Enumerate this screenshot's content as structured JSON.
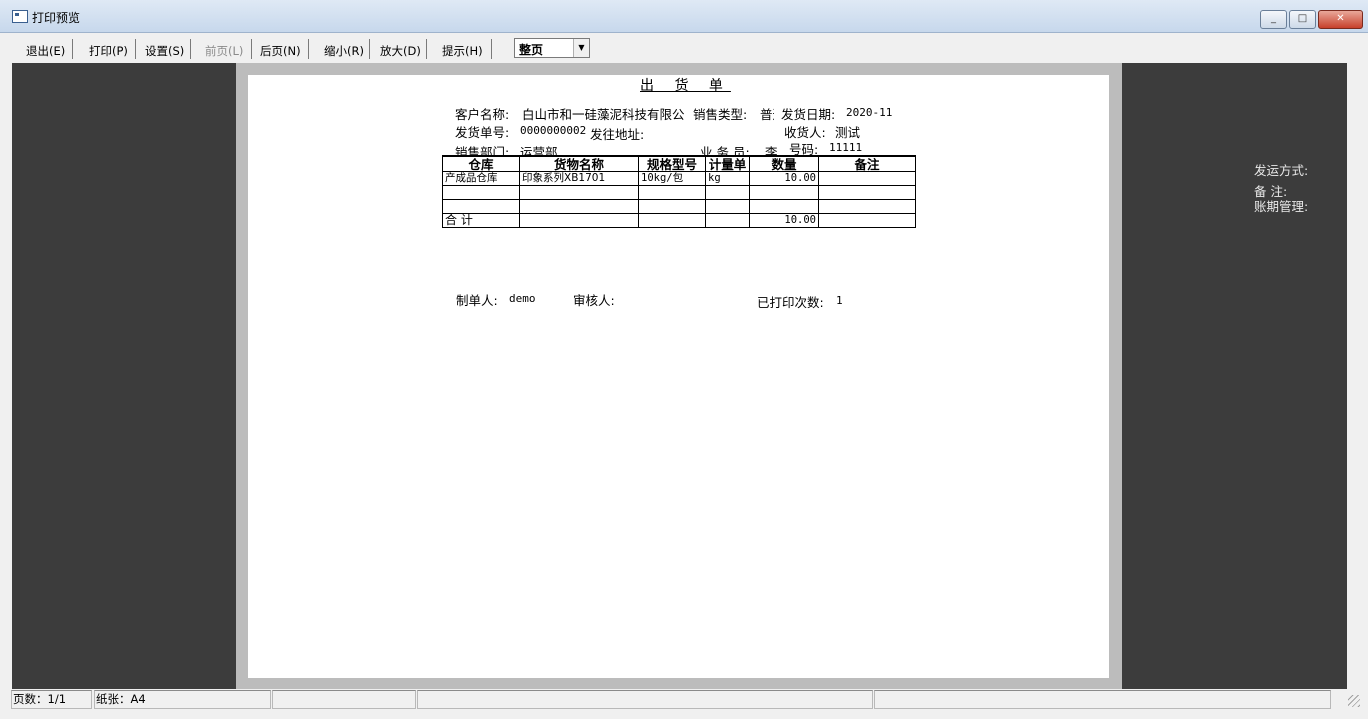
{
  "window": {
    "title": "打印预览",
    "minimize": "_",
    "maximize": "□",
    "close": "✕"
  },
  "toolbar": {
    "exit": "退出(E)",
    "print": "打印(P)",
    "settings": "设置(S)",
    "prev_page": "前页(L)",
    "next_page": "后页(N)",
    "zoom_out": "缩小(R)",
    "zoom_in": "放大(D)",
    "hint": "提示(H)",
    "zoom_value": "整页"
  },
  "document": {
    "title": "出 货 单",
    "customer_label": "客户名称:",
    "customer_value": "白山市和一硅藻泥科技有限公",
    "sales_type_label": "销售类型:",
    "sales_type_value": "普通",
    "ship_date_label": "发货日期:",
    "ship_date_value": "2020-11",
    "ship_no_label": "发货单号:",
    "ship_no_value": "0000000002",
    "ship_addr_label": "发往地址:",
    "receiver_label": "收货人:",
    "receiver_value": "测试",
    "dept_label": "销售部门:",
    "dept_value": "运营部",
    "salesman_label": "业 务 员:",
    "salesman_value": "李",
    "code_label": "号码:",
    "code_value": "11111",
    "table": {
      "headers": [
        "仓库",
        "货物名称",
        "规格型号",
        "计量单",
        "数量",
        "备注"
      ],
      "rows": [
        [
          "产成品仓库",
          "印象系列XB1701",
          "10kg/包",
          "kg",
          "10.00",
          ""
        ],
        [
          "",
          "",
          "",
          "",
          "",
          ""
        ],
        [
          "",
          "",
          "",
          "",
          "",
          ""
        ]
      ],
      "total_label": "合  计",
      "total_qty": "10.00"
    },
    "maker_label": "制单人:",
    "maker_value": "demo",
    "reviewer_label": "审核人:",
    "print_count_label": "已打印次数:",
    "print_count_value": "1"
  },
  "offpage": {
    "ship_method": "发运方式:",
    "remark": "备   注:",
    "account_mgmt": "账期管理:"
  },
  "status": {
    "pages": "页数：1/1",
    "paper": "纸张：A4"
  }
}
